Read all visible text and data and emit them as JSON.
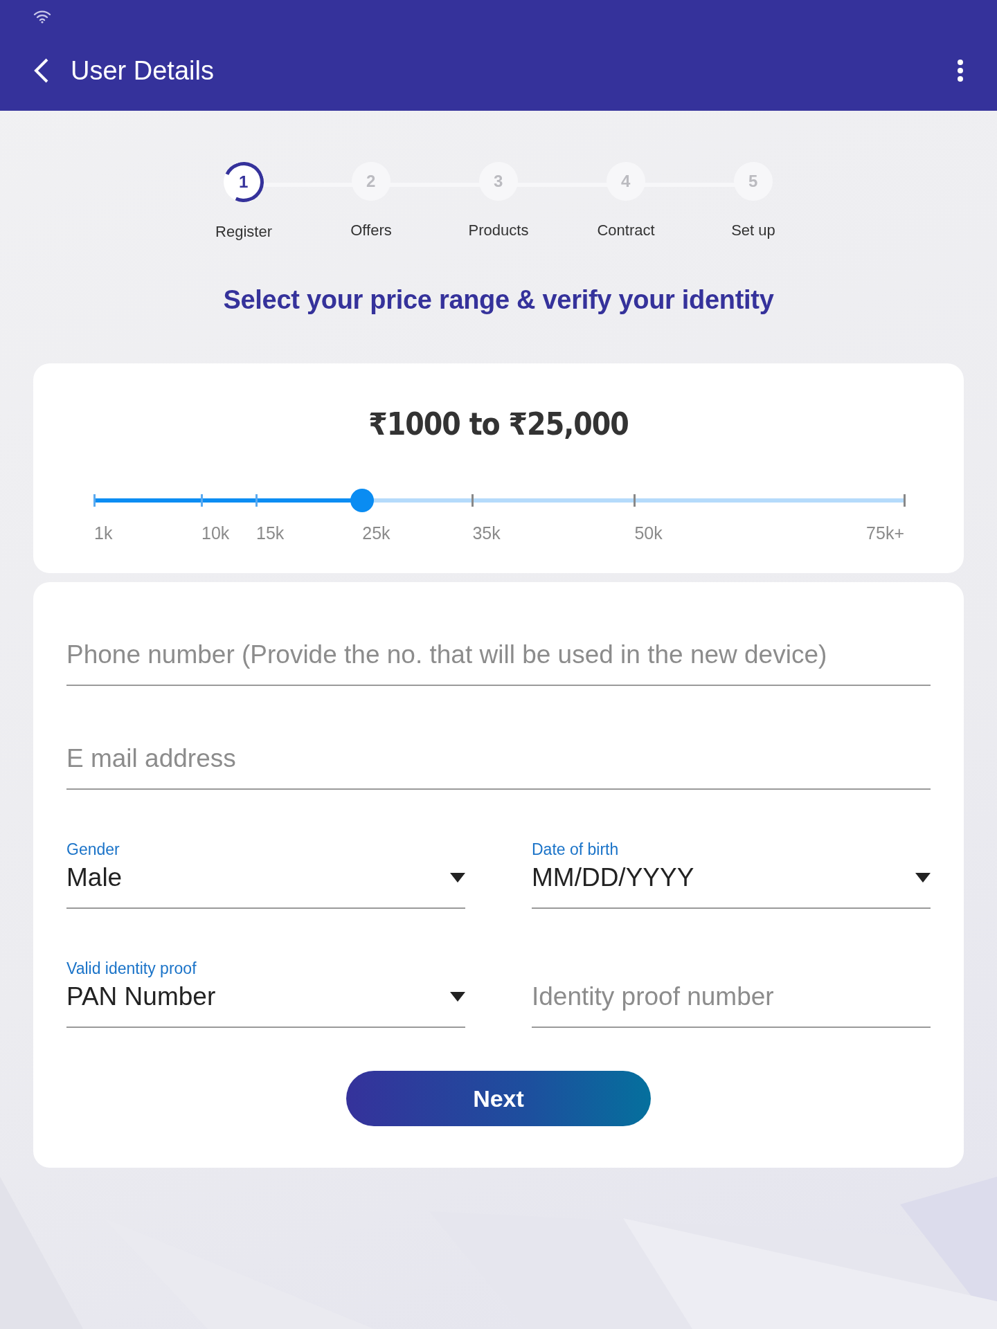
{
  "app_bar": {
    "title": "User Details"
  },
  "steps": [
    {
      "number": "1",
      "label": "Register",
      "selected": true
    },
    {
      "number": "2",
      "label": "Offers",
      "selected": false
    },
    {
      "number": "3",
      "label": "Products",
      "selected": false
    },
    {
      "number": "4",
      "label": "Contract",
      "selected": false
    },
    {
      "number": "5",
      "label": "Set up",
      "selected": false
    }
  ],
  "heading": "Select your price range & verify your identity",
  "price_range": {
    "reading": "₹1000 to ₹25,000",
    "level": 0.331,
    "ticks": [
      "1k",
      "10k",
      "15k",
      "25k",
      "35k",
      "50k",
      "75k+"
    ]
  },
  "fields": [
    {
      "kind": "text",
      "placeholder": "Phone number (Provide the no. that will be used in the new device)"
    },
    {
      "kind": "text",
      "placeholder": "E mail address"
    },
    {
      "kind": "dropdown",
      "label": "Gender",
      "value": "Male"
    },
    {
      "kind": "dropdown",
      "label": "Date of birth",
      "value": "MM/DD/YYYY"
    },
    {
      "kind": "dropdown",
      "label": "Valid identity proof",
      "value": "PAN Number"
    },
    {
      "kind": "text",
      "placeholder": "Identity proof number"
    }
  ],
  "button": "Next"
}
